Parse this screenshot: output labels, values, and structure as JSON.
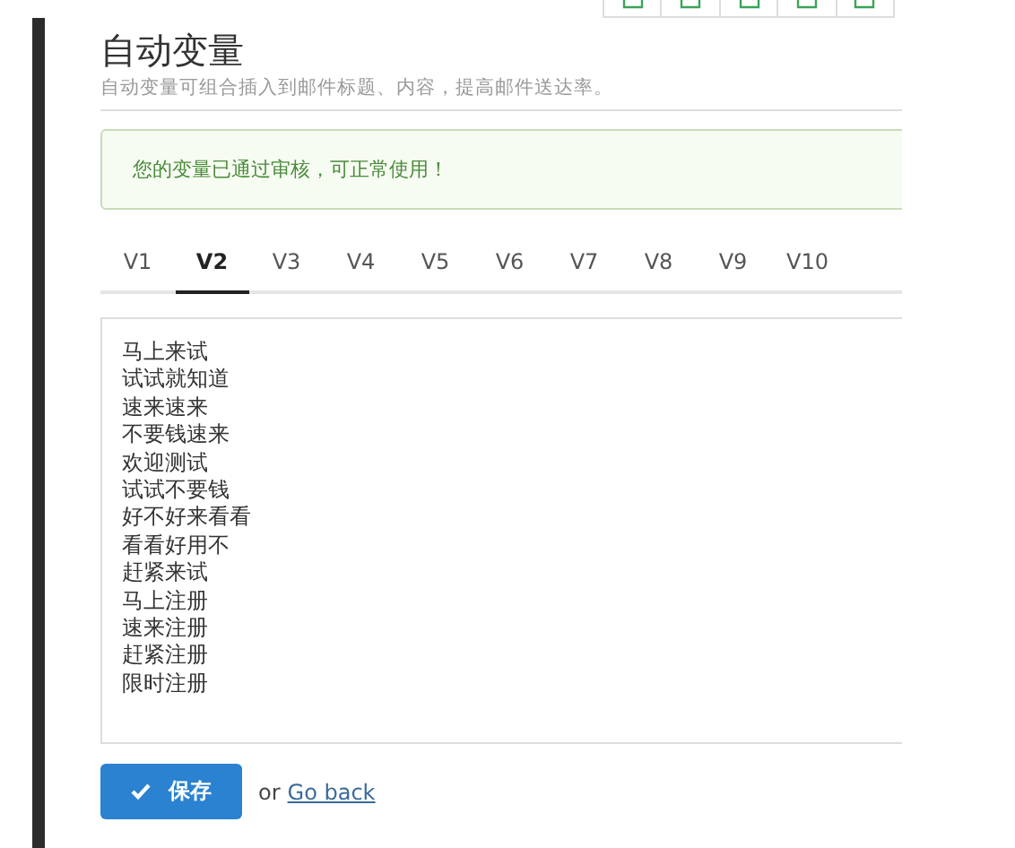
{
  "header": {
    "title": "自动变量",
    "subtitle": "自动变量可组合插入到邮件标题、内容，提高邮件送达率。"
  },
  "alert": {
    "message": "您的变量已通过审核，可正常使用！"
  },
  "tabs": [
    {
      "label": "V1",
      "selected": false
    },
    {
      "label": "V2",
      "selected": true
    },
    {
      "label": "V3",
      "selected": false
    },
    {
      "label": "V4",
      "selected": false
    },
    {
      "label": "V5",
      "selected": false
    },
    {
      "label": "V6",
      "selected": false
    },
    {
      "label": "V7",
      "selected": false
    },
    {
      "label": "V8",
      "selected": false
    },
    {
      "label": "V9",
      "selected": false
    },
    {
      "label": "V10",
      "selected": false
    }
  ],
  "editor": {
    "lines": [
      "马上来试",
      "试试就知道",
      "速来速来",
      "不要钱速来",
      "欢迎测试",
      "试试不要钱",
      "好不好来看看",
      "看看好用不",
      "赶紧来试",
      "马上注册",
      "速来注册",
      "赶紧注册",
      "限时注册"
    ]
  },
  "actions": {
    "save": "保存",
    "or": "or",
    "back": "Go back"
  }
}
